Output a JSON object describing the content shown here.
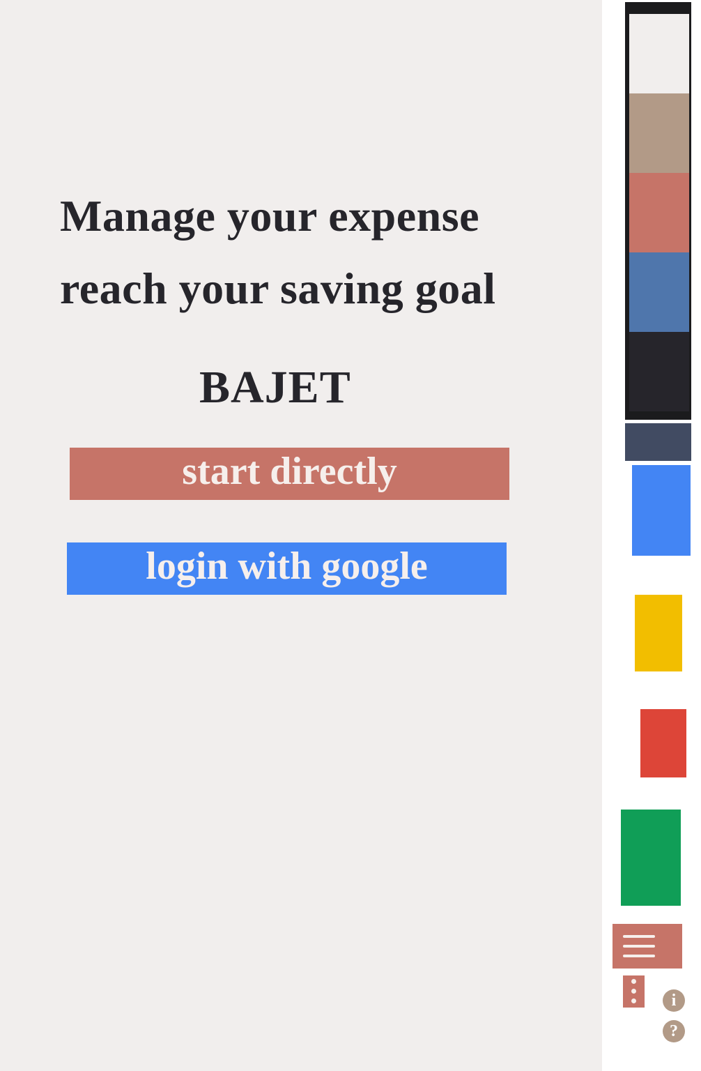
{
  "hero": {
    "line1": "Manage your expense",
    "line2": "reach your saving goal",
    "brand": "BAJET"
  },
  "actions": {
    "start_label": "start directly",
    "google_label": "login with google"
  },
  "palette": {
    "swatches": [
      "#f1eeed",
      "#b29a87",
      "#c67468",
      "#4f76ac",
      "#26252b"
    ],
    "chips": [
      "#414b62",
      "#4385f4",
      "#f2be00",
      "#dd4538",
      "#109e57"
    ]
  },
  "side_icons": {
    "menu_icon": "hamburger-menu-icon",
    "more_icon": "vertical-dots-icon",
    "info_glyph": "i",
    "help_glyph": "?"
  }
}
